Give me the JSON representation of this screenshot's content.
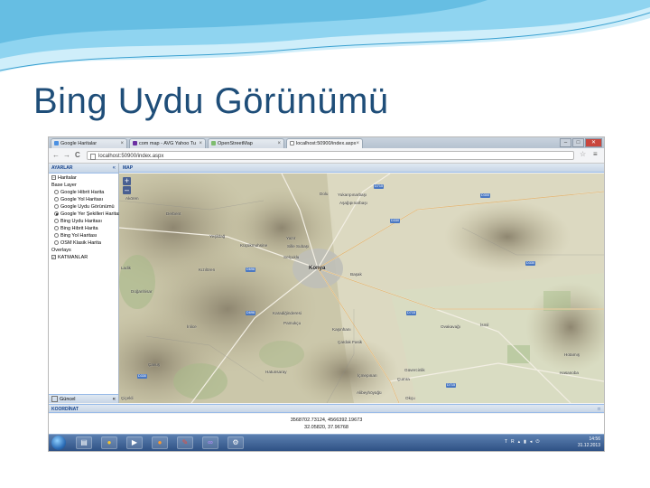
{
  "slide": {
    "title": "Bing Uydu Görünümü",
    "colors": {
      "title": "#1f4e79",
      "wave": "#5bb8e0"
    }
  },
  "browser": {
    "tabs": [
      {
        "label": "Google Haritalar",
        "icon": "google-icon",
        "active": false
      },
      {
        "label": "com map - AVG Yahoo Tu",
        "icon": "yahoo-icon",
        "active": false
      },
      {
        "label": "OpenStreetMap",
        "icon": "osm-icon",
        "active": false
      },
      {
        "label": "localhost:50900/index.aspx",
        "icon": "page-icon",
        "active": true
      }
    ],
    "window_buttons": {
      "minimize": "–",
      "maximize": "□",
      "close": "✕"
    },
    "address": "localhost:50900/index.aspx",
    "nav": {
      "back": "←",
      "forward": "→",
      "reload": "C"
    },
    "star": "☆",
    "menu": "≡"
  },
  "sidebar": {
    "header": "AYARLAR",
    "root": "Haritalar",
    "base_layer_label": "Base Layer",
    "base_layers": [
      {
        "label": "Google Hibrit Harita",
        "selected": false
      },
      {
        "label": "Google Yol Haritası",
        "selected": false
      },
      {
        "label": "Google Uydu Görünümü",
        "selected": false
      },
      {
        "label": "Google Yer Şekilleri Haritası",
        "selected": true
      },
      {
        "label": "Bing Uydu Haritası",
        "selected": false
      },
      {
        "label": "Bing Hibrit Harita",
        "selected": false
      },
      {
        "label": "Bing Yol Haritası",
        "selected": false
      },
      {
        "label": "OSM Klasik Harita",
        "selected": false
      }
    ],
    "overlays_label": "Overlays",
    "overlays": [
      {
        "label": "KATMANLAR",
        "checked": true
      }
    ],
    "bottom_item": "Güncel"
  },
  "map": {
    "header": "MAP",
    "zoom_in": "+",
    "zoom_out": "–",
    "labels": {
      "city": "Konya",
      "akoren": "Akören",
      "derbent": "Derbent",
      "doganhisar": "Doğanhisar",
      "kuzolen": "Kızılören",
      "dolu": "Dolu",
      "yukarpinarbasi": "Yukarıpınarbaşı",
      "asagipinarbasi": "Aşağıpınarbaşı",
      "kucukmuhsine": "Küçükmuhsine",
      "yazir": "Yazır",
      "sille": "Sille Subaşı",
      "selcuklu": "Selçuklu",
      "basak": "Başak",
      "karadiginderesi": "Karadiğinderesi",
      "pamukcu": "Pamukçu",
      "kasinhani": "Kaşınhanı",
      "cardak": "Çardak Fasik",
      "ovakavagi": "Ovakavağı",
      "ismil": "İsmil",
      "icmepinar": "İçmepınarı",
      "guvercinlik": "Güvercinlik",
      "cumra": "Çumra",
      "alibeyhoyugu": "Alibeyhöyüğü",
      "hatunsaray": "Hatunsaray",
      "hotamis": "Hotamış",
      "hasanoba": "Hasanoba",
      "okcu": "Okçu",
      "cicekli": "Çiçekli",
      "bozkir_yaka": "Yaka",
      "beysehir": "Beyşehir",
      "inlice": "İnlice",
      "seydisehir": "Seydişehir",
      "ladik": "Ladik",
      "cavus": "Çavuş",
      "yesildag": "Yeşildağ"
    },
    "road_shields": [
      "D715",
      "D300",
      "D330",
      "D330",
      "D715",
      "D696",
      "D696",
      "D715",
      "D330"
    ]
  },
  "coord": {
    "header": "KOORDİNAT",
    "projected": "3568702.73124, 4566392.19673",
    "geographic": "32.05820, 37.96768"
  },
  "taskbar": {
    "icons": [
      "start-icon",
      "explorer-icon",
      "chrome-icon",
      "media-icon",
      "firefox-icon",
      "paint-icon",
      "visual-studio-icon",
      "tool-icon"
    ],
    "language": "TR",
    "time": "14:56",
    "date": "31.12.2013"
  }
}
